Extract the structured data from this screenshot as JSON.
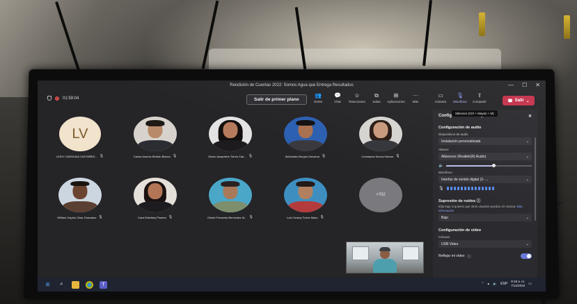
{
  "window": {
    "title": "Rendición de Cuentas 2022: Somos Agua que Entrega Resultados",
    "min": "—",
    "max": "☐",
    "close": "✕"
  },
  "toolbar": {
    "elapsed": "01:59:04",
    "bring_to_front": "Salir de primer plano",
    "tools": [
      {
        "glyph": "👥",
        "label": "Gente",
        "icon": "people-icon"
      },
      {
        "glyph": "💬",
        "label": "Chat",
        "icon": "chat-icon"
      },
      {
        "glyph": "☺",
        "label": "Reacciones",
        "icon": "reactions-icon"
      },
      {
        "glyph": "⧉",
        "label": "Salas",
        "icon": "rooms-icon"
      },
      {
        "glyph": "⊞",
        "label": "Aplicaciones",
        "icon": "apps-icon"
      },
      {
        "glyph": "···",
        "label": "Más",
        "icon": "more-icon"
      }
    ],
    "media": [
      {
        "glyph": "▭",
        "label": "Cámara",
        "icon": "camera-icon"
      },
      {
        "glyph": "🎙",
        "label": "Micrófono",
        "icon": "microphone-icon"
      },
      {
        "glyph": "⇪",
        "label": "Compartir",
        "icon": "share-icon"
      }
    ],
    "leave": "Salir",
    "leave_chevron": "⌄",
    "tooltip": "Silenciar (Ctrl + Mayús + M)"
  },
  "participants": [
    {
      "name": "LEIDY CAROLINA CASTAÑED...",
      "initials": "LV"
    },
    {
      "name": "Carlos Arsenio Beltrán Blanco"
    },
    {
      "name": "Gloria Jacqueline Torres Cab..."
    },
    {
      "name": "Alcibíades Burgos Dulcama"
    },
    {
      "name": "Constanza Novoa Hamon"
    },
    {
      "name": "William Ospino Chaz Granados"
    },
    {
      "name": "Carol Estefany Pinares"
    },
    {
      "name": "Edwin Fernando Bermudez M..."
    },
    {
      "name": "Luis Yovany Torres Maso"
    },
    {
      "name": "",
      "overflow": "+702"
    }
  ],
  "settings": {
    "header": "Configuración del dispositivo",
    "close": "✕",
    "audio": {
      "title": "Configuración de audio",
      "device_label": "Dispositivos de audio",
      "device_value": "Instalación personalizada",
      "speaker_label": "Altavoz",
      "speaker_value": "Altavoces (Realtek(R) Audio)",
      "speaker_volume": 0.55,
      "mic_label": "Micrófono",
      "mic_value": "Interfaz de sonido digital (2- ..."
    },
    "noise": {
      "title": "Supresión de ruidos",
      "description": "Elija bajo si quieres que otros usuarios puedan oír música.",
      "link": "Más información",
      "value": "Bajo"
    },
    "video": {
      "title": "Configuración de vídeo",
      "camera_label": "Cámara",
      "camera_value": "USB Video",
      "mirror_label": "Reflejar mi vídeo",
      "mirror_on": true
    }
  },
  "taskbar": {
    "time": "9:18 a. m.",
    "date": "7/12/2022",
    "tray": "ESP"
  }
}
